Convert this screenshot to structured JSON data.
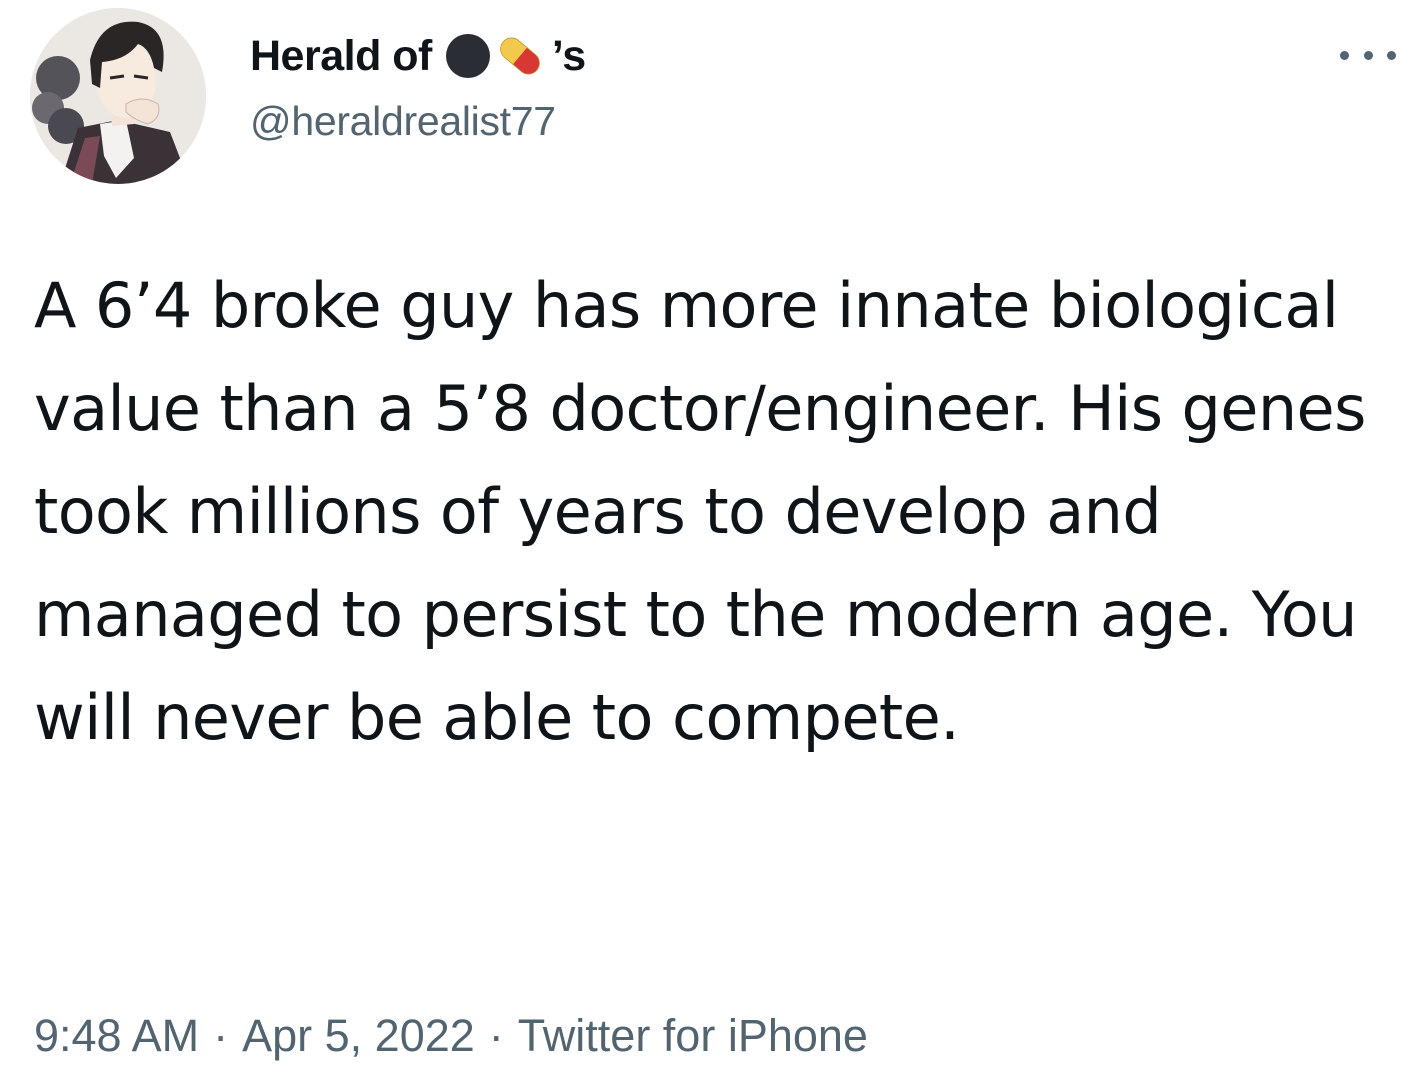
{
  "tweet": {
    "author": {
      "display_name": "Herald of",
      "name_suffix": "’s",
      "handle": "@heraldrealist77",
      "emoji_icons": [
        "black-circle-icon",
        "pill-icon"
      ]
    },
    "text": "A 6’4 broke guy has more innate biological value than a 5’8 doctor/engineer. His genes took millions of years to develop and managed to persist to the modern age. You will never be able to compete.",
    "time": "9:48 AM",
    "date": "Apr 5, 2022",
    "source": "Twitter for iPhone",
    "separator": "·",
    "more_icon": "more-horizontal-icon"
  },
  "colors": {
    "text": "#0f1419",
    "secondary": "#536471",
    "background": "#ffffff"
  }
}
